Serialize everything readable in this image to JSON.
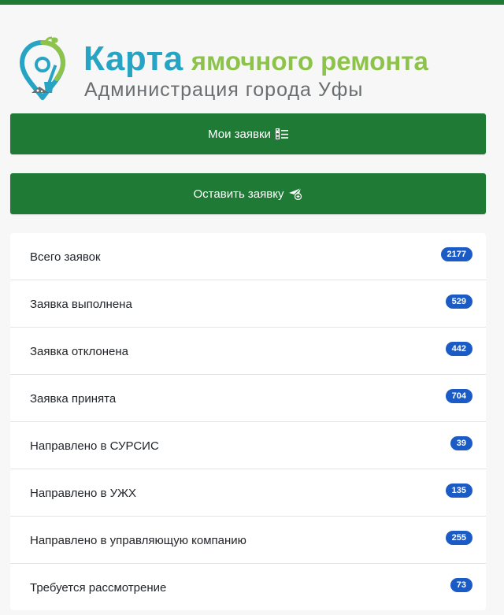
{
  "header": {
    "title_word1": "Карта",
    "title_word2": "ямочного ремонта",
    "subtitle": "Администрация города Уфы"
  },
  "buttons": {
    "my_requests": "Мои заявки",
    "leave_request": "Оставить заявку"
  },
  "stats": [
    {
      "label": "Всего заявок",
      "count": "2177"
    },
    {
      "label": "Заявка выполнена",
      "count": "529"
    },
    {
      "label": "Заявка отклонена",
      "count": "442"
    },
    {
      "label": "Заявка принята",
      "count": "704"
    },
    {
      "label": "Направлено в СУРСИС",
      "count": "39"
    },
    {
      "label": "Направлено в УЖХ",
      "count": "135"
    },
    {
      "label": "Направлено в управляющую компанию",
      "count": "255"
    },
    {
      "label": "Требуется рассмотрение",
      "count": "73"
    }
  ],
  "colors": {
    "primary_green": "#1e7a34",
    "logo_blue": "#27a4c4",
    "logo_green": "#8dc34a",
    "badge_blue": "#1a5bc6"
  },
  "icons": {
    "logo": "map-pin-shovel-logo",
    "my_requests": "list-check-icon",
    "leave_request": "paper-plane-plus-icon"
  }
}
